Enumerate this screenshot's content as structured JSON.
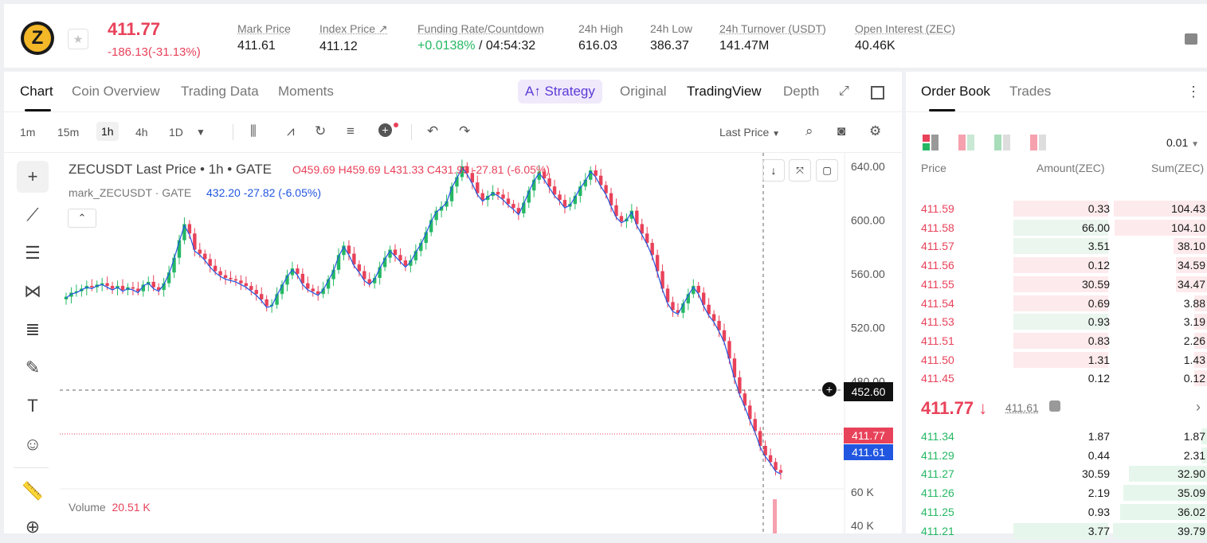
{
  "header": {
    "coin_symbol": "Z",
    "last_price": "411.77",
    "change": "-186.13(-31.13%)",
    "stats": [
      {
        "label": "Mark Price",
        "value": "411.61"
      },
      {
        "label": "Index Price ↗",
        "value": "411.12"
      },
      {
        "label": "Funding Rate/Countdown",
        "value_green": "+0.0138%",
        "value_rest": " / 04:54:32"
      },
      {
        "label": "24h High",
        "value": "616.03"
      },
      {
        "label": "24h Low",
        "value": "386.37"
      },
      {
        "label": "24h Turnover (USDT)",
        "value": "141.47M"
      },
      {
        "label": "Open Interest (ZEC)",
        "value": "40.46K"
      }
    ]
  },
  "tabs": {
    "chart": "Chart",
    "coin_overview": "Coin Overview",
    "trading_data": "Trading Data",
    "moments": "Moments",
    "strategy": "A↑ Strategy",
    "original": "Original",
    "tradingview": "TradingView",
    "depth": "Depth"
  },
  "toolbar": {
    "timeframes": [
      "1m",
      "15m",
      "1h",
      "4h",
      "1D"
    ],
    "active_timeframe": "1h",
    "last_price_select": "Last Price"
  },
  "chart_legend": {
    "symbol": "ZECUSDT Last Price • 1h • GATE",
    "ohlc": "O459.69  H459.69  L431.33  C431.99  -27.81  (-6.05%)",
    "mark_label": "mark_ZECUSDT · GATE",
    "mark_values": "432.20  -27.82  (-6.05%)",
    "volume_label": "Volume",
    "volume_value": "20.51 K"
  },
  "axis": {
    "ticks": [
      "640.00",
      "600.00",
      "560.00",
      "520.00",
      "480.00",
      "440.00"
    ],
    "crosshair_value": "452.60",
    "last_tag": "411.77",
    "mark_tag": "411.61",
    "volume_ticks": [
      "60 K",
      "40 K"
    ]
  },
  "colors": {
    "up": "#25b864",
    "down": "#e8425a",
    "accent": "#5b3ad6",
    "mark_tag": "#2156e0"
  },
  "chart_data": {
    "type": "candlestick",
    "ylim": [
      400,
      650
    ],
    "closes": [
      543,
      546,
      547,
      549,
      551,
      550,
      552,
      553,
      551,
      549,
      551,
      548,
      550,
      549,
      547,
      552,
      554,
      550,
      548,
      553,
      561,
      572,
      585,
      597,
      590,
      578,
      575,
      571,
      566,
      562,
      559,
      557,
      556,
      555,
      553,
      551,
      548,
      545,
      541,
      536,
      537,
      545,
      552,
      559,
      564,
      560,
      553,
      549,
      547,
      545,
      549,
      556,
      563,
      574,
      581,
      575,
      567,
      562,
      556,
      553,
      557,
      565,
      572,
      578,
      574,
      570,
      566,
      570,
      577,
      583,
      591,
      600,
      607,
      610,
      614,
      625,
      632,
      640,
      635,
      628,
      620,
      615,
      618,
      621,
      619,
      616,
      612,
      609,
      605,
      613,
      622,
      630,
      636,
      631,
      625,
      619,
      615,
      610,
      612,
      618,
      625,
      630,
      637,
      633,
      626,
      620,
      611,
      603,
      599,
      601,
      607,
      597,
      590,
      583,
      574,
      562,
      549,
      539,
      533,
      531,
      538,
      545,
      551,
      546,
      537,
      530,
      525,
      518,
      510,
      497,
      483,
      471,
      462,
      452,
      443,
      432,
      425,
      420,
      414,
      412
    ]
  },
  "orderbook": {
    "tabs": [
      "Order Book",
      "Trades"
    ],
    "precision": "0.01",
    "headers": {
      "price": "Price",
      "amount": "Amount(ZEC)",
      "sum": "Sum(ZEC)"
    },
    "asks": [
      {
        "price": "411.59",
        "amount": "0.33",
        "sum": "104.43",
        "amt_frac": 0.02,
        "sum_frac": 1.0
      },
      {
        "price": "411.58",
        "amount": "66.00",
        "sum": "104.10",
        "amt_frac": 1.0,
        "sum_frac": 0.99
      },
      {
        "price": "411.57",
        "amount": "3.51",
        "sum": "38.10",
        "amt_frac": 0.06,
        "sum_frac": 0.36
      },
      {
        "price": "411.56",
        "amount": "0.12",
        "sum": "34.59",
        "amt_frac": 0.01,
        "sum_frac": 0.33
      },
      {
        "price": "411.55",
        "amount": "30.59",
        "sum": "34.47",
        "amt_frac": 0.46,
        "sum_frac": 0.33
      },
      {
        "price": "411.54",
        "amount": "0.69",
        "sum": "3.88",
        "amt_frac": 0.02,
        "sum_frac": 0.04
      },
      {
        "price": "411.53",
        "amount": "0.93",
        "sum": "3.19",
        "amt_frac": 0.02,
        "sum_frac": 0.03
      },
      {
        "price": "411.51",
        "amount": "0.83",
        "sum": "2.26",
        "amt_frac": 0.02,
        "sum_frac": 0.02
      },
      {
        "price": "411.50",
        "amount": "1.31",
        "sum": "1.43",
        "amt_frac": 0.02,
        "sum_frac": 0.01
      },
      {
        "price": "411.45",
        "amount": "0.12",
        "sum": "0.12",
        "amt_frac": 0.01,
        "sum_frac": 0.001
      }
    ],
    "current_price": "411.77 ↓",
    "mark_price": "411.61",
    "bids": [
      {
        "price": "411.34",
        "amount": "1.87",
        "sum": "1.87",
        "amt_frac": 0.0,
        "sum_frac": 0.02
      },
      {
        "price": "411.29",
        "amount": "0.44",
        "sum": "2.31",
        "amt_frac": 0.0,
        "sum_frac": 0.02
      },
      {
        "price": "411.27",
        "amount": "30.59",
        "sum": "32.90",
        "amt_frac": 0.0,
        "sum_frac": 0.28
      },
      {
        "price": "411.26",
        "amount": "2.19",
        "sum": "35.09",
        "amt_frac": 0.0,
        "sum_frac": 0.3
      },
      {
        "price": "411.25",
        "amount": "0.93",
        "sum": "36.02",
        "amt_frac": 0.0,
        "sum_frac": 0.31
      },
      {
        "price": "411.21",
        "amount": "3.77",
        "sum": "39.79",
        "amt_frac": 0.06,
        "sum_frac": 0.34
      }
    ]
  }
}
